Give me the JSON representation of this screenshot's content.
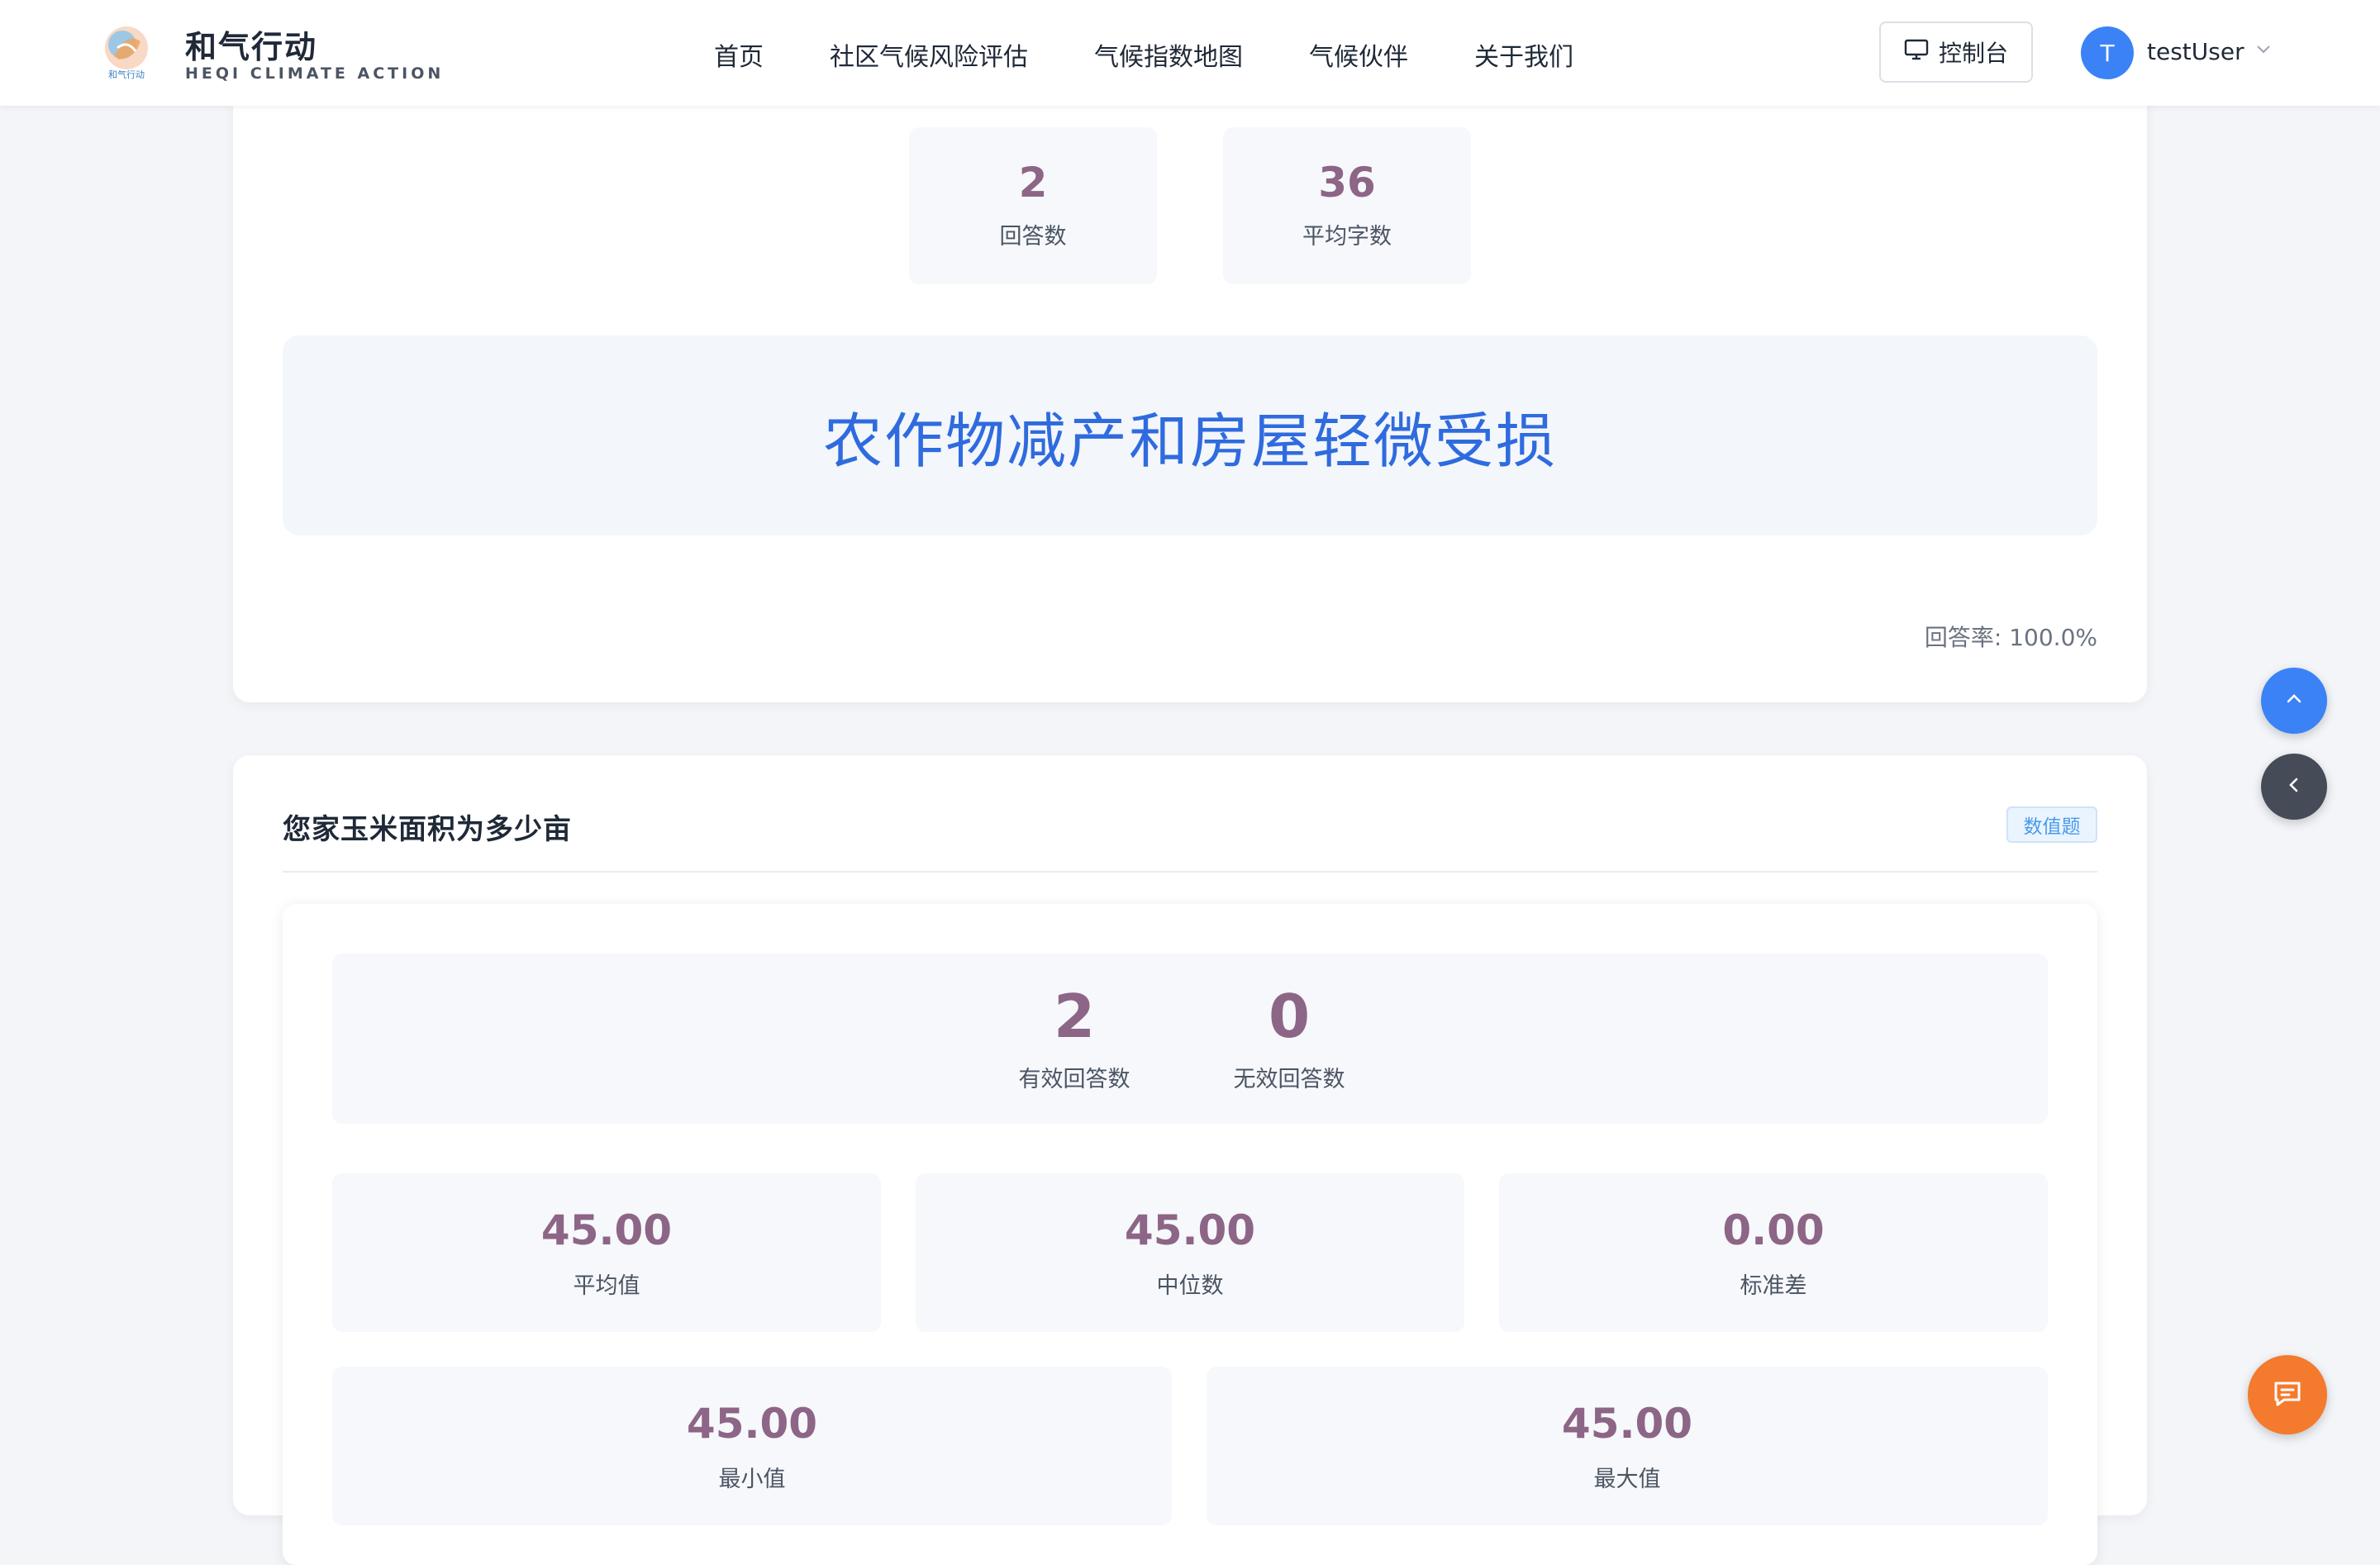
{
  "header": {
    "logo_text": "和气行动",
    "brand_name": "和气行动",
    "brand_sub": "HEQI CLIMATE ACTION",
    "nav": [
      "首页",
      "社区气候风险评估",
      "气候指数地图",
      "气候伙伴",
      "关于我们"
    ],
    "console_label": "控制台",
    "avatar_letter": "T",
    "username": "testUser"
  },
  "question_prev": {
    "stats": [
      {
        "value": "2",
        "label": "回答数"
      },
      {
        "value": "36",
        "label": "平均字数"
      }
    ],
    "answer_text": "农作物减产和房屋轻微受损",
    "response_rate": "回答率: 100.0%"
  },
  "question_current": {
    "title": "您家玉米面积为多少亩",
    "tag": "数值题",
    "counts": [
      {
        "value": "2",
        "label": "有效回答数"
      },
      {
        "value": "0",
        "label": "无效回答数"
      }
    ],
    "stats_row1": [
      {
        "value": "45.00",
        "label": "平均值"
      },
      {
        "value": "45.00",
        "label": "中位数"
      },
      {
        "value": "0.00",
        "label": "标准差"
      }
    ],
    "stats_row2": [
      {
        "value": "45.00",
        "label": "最小值"
      },
      {
        "value": "45.00",
        "label": "最大值"
      }
    ]
  },
  "icons": {
    "console": "monitor-icon",
    "caret": "chevron-down-icon",
    "scroll_top": "chevron-up-icon",
    "collapse": "chevron-left-icon",
    "chat": "chat-icon"
  },
  "colors": {
    "accent_blue": "#3b82f6",
    "stat_value": "#8d6586",
    "answer_text": "#2f6bdf",
    "chat_button": "#f47a2d",
    "dark_button": "#454c57"
  }
}
